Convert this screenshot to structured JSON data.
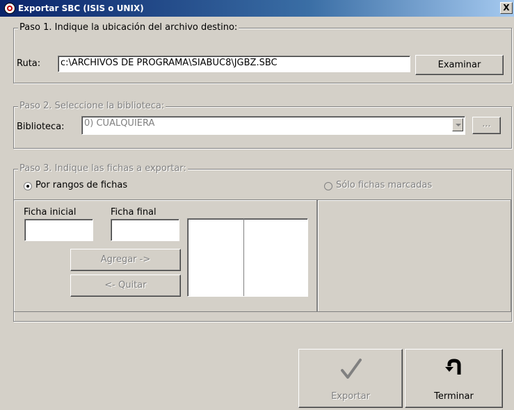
{
  "window": {
    "title": "Exportar SBC (ISIS o UNIX)",
    "close_glyph": "X"
  },
  "step1": {
    "legend": "Paso 1. Indique la ubicación del archivo destino:",
    "ruta_label": "Ruta:",
    "ruta_value": "c:\\ARCHIVOS DE PROGRAMA\\SIABUC8\\JGBZ.SBC",
    "examinar_label": "Examinar"
  },
  "step2": {
    "legend": "Paso 2. Seleccione la biblioteca:",
    "biblioteca_label": "Biblioteca:",
    "biblioteca_value": "0) CUALQUIERA",
    "ellipsis_label": "..."
  },
  "step3": {
    "legend": "Paso 3. Indique las fichas a exportar:",
    "radio_rangos": "Por rangos de fichas",
    "radio_rangos_checked": true,
    "radio_marcadas": "Sólo fichas marcadas",
    "ficha_inicial_label": "Ficha inicial",
    "ficha_final_label": "Ficha final",
    "ficha_inicial_value": "",
    "ficha_final_value": "",
    "agregar_label": "Agregar ->",
    "quitar_label": "<- Quitar"
  },
  "actions": {
    "exportar_label": "Exportar",
    "exportar_icon": "checkmark-icon",
    "terminar_label": "Terminar",
    "terminar_icon": "u-turn-arrow-icon"
  }
}
